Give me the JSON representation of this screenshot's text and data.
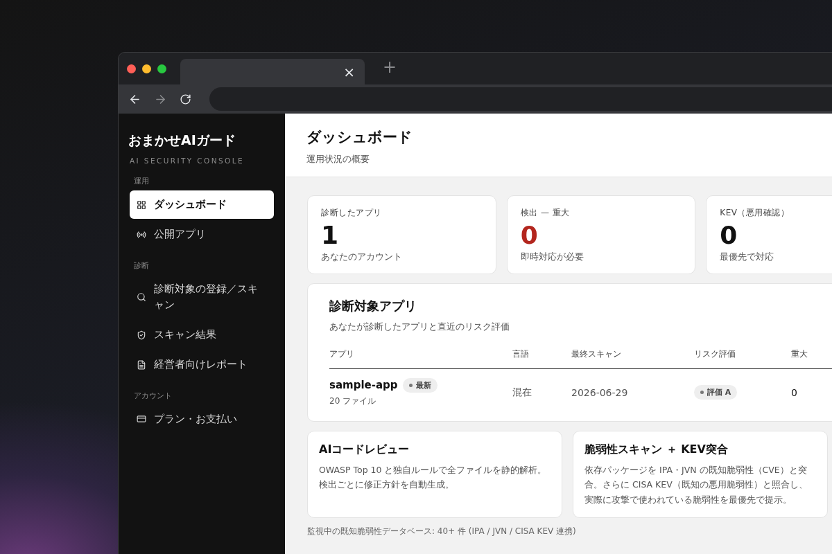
{
  "browser": {
    "tab_close": "×",
    "new_tab": "+"
  },
  "sidebar": {
    "brand": "おまかせAIガード",
    "tagline": "AI SECURITY CONSOLE",
    "sections": [
      {
        "heading": "運用",
        "items": [
          {
            "label": "ダッシュボード",
            "selected": true
          },
          {
            "label": "公開アプリ",
            "selected": false
          }
        ]
      },
      {
        "heading": "診断",
        "items": [
          {
            "label": "診断対象の登録／スキャン",
            "selected": false
          },
          {
            "label": "スキャン結果",
            "selected": false
          },
          {
            "label": "経営者向けレポート",
            "selected": false
          }
        ]
      },
      {
        "heading": "アカウント",
        "items": [
          {
            "label": "プラン・お支払い",
            "selected": false
          }
        ]
      }
    ]
  },
  "header": {
    "title": "ダッシュボード",
    "subtitle": "運用状況の概要"
  },
  "stats": [
    {
      "label": "診断したアプリ",
      "value": "1",
      "note": "あなたのアカウント",
      "alert": false
    },
    {
      "label": "検出 — 重大",
      "value": "0",
      "note": "即時対応が必要",
      "alert": true
    },
    {
      "label": "KEV（悪用確認）",
      "value": "0",
      "note": "最優先で対応",
      "alert": false
    }
  ],
  "apps_panel": {
    "title": "診断対象アプリ",
    "subtitle": "あなたが診断したアプリと直近のリスク評価",
    "columns": [
      "アプリ",
      "言語",
      "最終スキャン",
      "リスク評価",
      "重大"
    ],
    "rows": [
      {
        "name": "sample-app",
        "badge": "最新",
        "files": "20 ファイル",
        "language": "混在",
        "last_scan": "2026-06-29",
        "risk": "評価 A",
        "critical": "0"
      }
    ]
  },
  "features": [
    {
      "title": "AIコードレビュー",
      "body": "OWASP Top 10 と独自ルールで全ファイルを静的解析。検出ごとに修正方針を自動生成。"
    },
    {
      "title": "脆弱性スキャン ＋ KEV突合",
      "body": "依存パッケージを IPA・JVN の既知脆弱性（CVE）と突合。さらに CISA KEV（既知の悪用脆弱性）と照合し、実際に攻撃で使われている脆弱性を最優先で提示。"
    }
  ],
  "footer_note": "監視中の既知脆弱性データベース: 40+ 件 (IPA / JVN / CISA KEV 連携)"
}
